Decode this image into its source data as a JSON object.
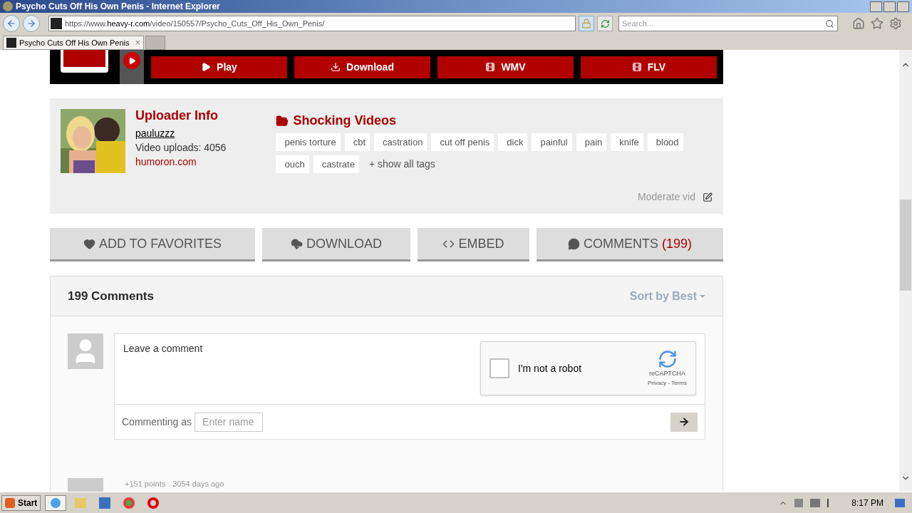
{
  "window": {
    "title": "Psycho Cuts Off His Own Penis - Internet Explorer"
  },
  "address_bar": {
    "url_prefix": "https://www.",
    "url_domain": "heavy-r.com",
    "url_path": "/video/150557/Psycho_Cuts_Off_His_Own_Penis/"
  },
  "search": {
    "placeholder": "Search..."
  },
  "tabs": [
    {
      "label": "Psycho Cuts Off His Own Penis",
      "close": "×",
      "selected": true
    }
  ],
  "player_buttons": [
    {
      "label": "Play",
      "kind": "play"
    },
    {
      "label": "Download",
      "kind": "download"
    },
    {
      "label": "WMV",
      "kind": "film"
    },
    {
      "label": "FLV",
      "kind": "film"
    }
  ],
  "uploader": {
    "heading": "Uploader Info",
    "username": "pauluzzz",
    "uploads": "Video uploads: 4056",
    "site": "humoron.com"
  },
  "category": {
    "title": "Shocking Videos",
    "tags": [
      "penis torture",
      "cbt",
      "castration",
      "cut off penis",
      "dick",
      "painful",
      "pain",
      "knife",
      "blood",
      "ouch",
      "castrate"
    ],
    "show_all": "+ show all tags",
    "moderate": "Moderate vid"
  },
  "actions": [
    {
      "label": "ADD TO FAVORITES",
      "kind": "heart"
    },
    {
      "label": "DOWNLOAD",
      "kind": "cloud"
    },
    {
      "label": "EMBED",
      "kind": "code"
    },
    {
      "label": "COMMENTS",
      "kind": "comment",
      "count": "(199)"
    }
  ],
  "comments": {
    "heading": "199 Comments",
    "sort": "Sort by Best",
    "placeholder": "Leave a comment",
    "captcha": {
      "label": "I'm not a robot",
      "checked": false,
      "brand": "reCAPTCHA",
      "links": "Privacy - Terms"
    },
    "commenting_as": "Commenting as",
    "name_placeholder": "Enter name",
    "first": {
      "points": "+151 points",
      "age": "3054 days ago"
    }
  },
  "taskbar": {
    "start": "Start",
    "clock": "8:17 PM"
  }
}
